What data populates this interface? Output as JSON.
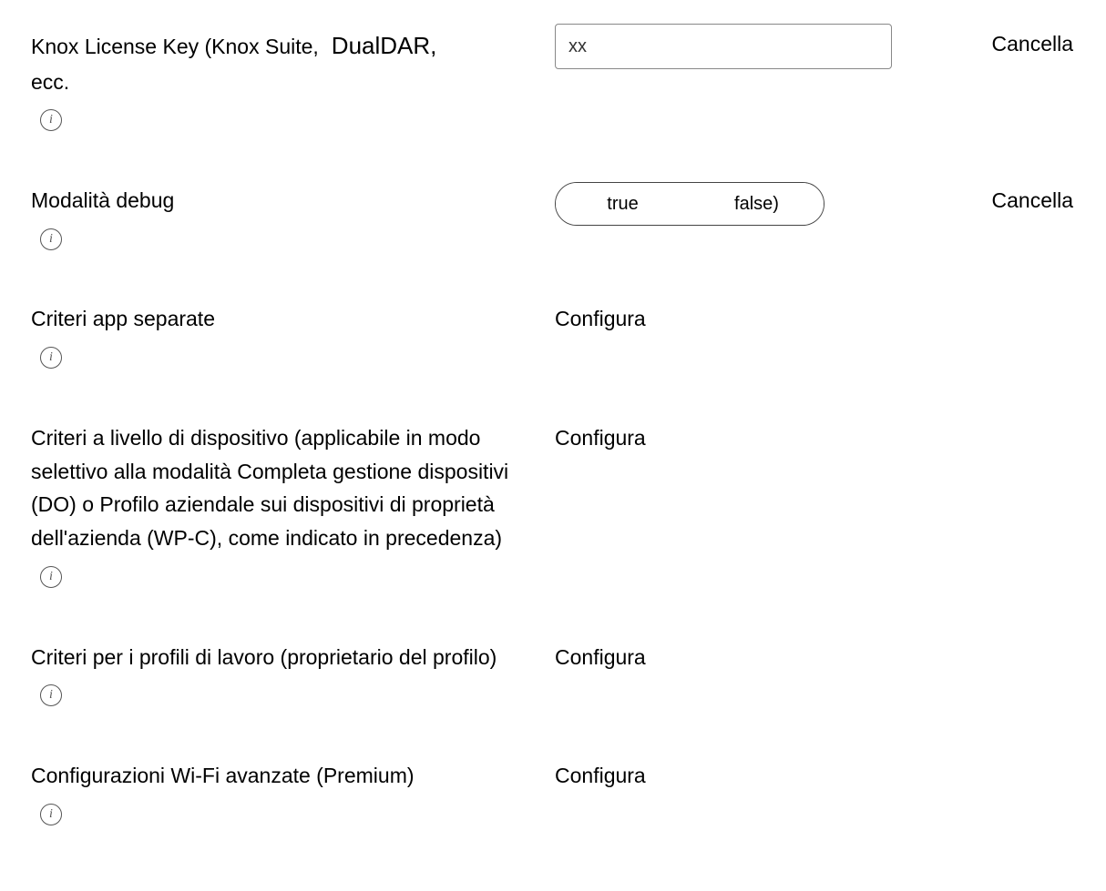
{
  "rows": {
    "license": {
      "label_main": "Knox License Key (Knox Suite,",
      "label_suffix": "DualDAR,",
      "label_line2": "ecc.",
      "value": "xx",
      "action": "Cancella"
    },
    "debug": {
      "label": "Modalità debug",
      "option_true": "true",
      "option_false": "false)",
      "action": "Cancella"
    },
    "separate_apps": {
      "label": "Criteri app separate",
      "action": "Configura"
    },
    "device_policies": {
      "label": "Criteri a livello di dispositivo (applicabile in modo selettivo alla modalità Completa gestione dispositivi (DO) o Profilo aziendale sui dispositivi di proprietà dell'azienda (WP-C), come indicato in precedenza)",
      "action": "Configura"
    },
    "work_profiles": {
      "label": "Criteri per i profili di lavoro (proprietario del profilo)",
      "action": "Configura"
    },
    "wifi": {
      "label": "Configurazioni Wi-Fi avanzate (Premium)",
      "action": "Configura"
    }
  }
}
